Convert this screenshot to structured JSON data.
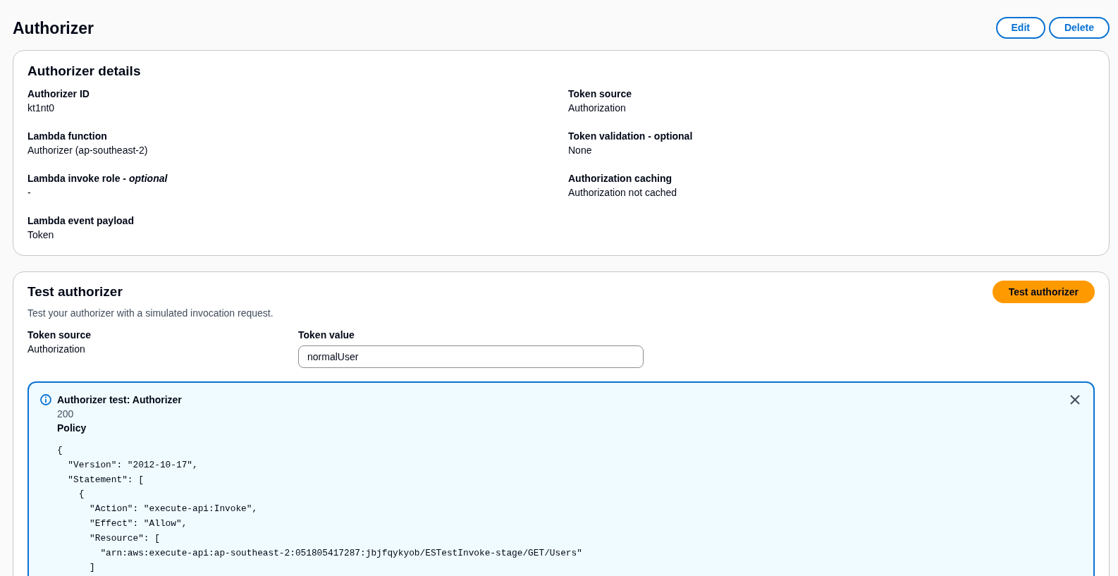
{
  "page": {
    "title": "Authorizer",
    "actions": [
      {
        "label": "Edit",
        "kind": "normal"
      },
      {
        "label": "Delete",
        "kind": "normal"
      }
    ]
  },
  "details": {
    "title": "Authorizer details",
    "columns": [
      [
        {
          "label": "Authorizer ID",
          "value": "kt1nt0"
        },
        {
          "label": "Lambda function",
          "value": "Authorizer (ap-southeast-2)"
        },
        {
          "label": "Lambda invoke role - *optional*",
          "value": "-"
        },
        {
          "label": "Lambda event payload",
          "value": "Token"
        }
      ],
      [
        {
          "label": "Token source",
          "value": "Authorization"
        },
        {
          "label": "Token validation - optional",
          "value": "None"
        },
        {
          "label": "Authorization caching",
          "value": "Authorization not cached"
        }
      ]
    ]
  },
  "test": {
    "title": "Test authorizer",
    "description": "Test your authorizer with a simulated invocation request.",
    "actions": [
      {
        "label": "Test authorizer",
        "kind": "primary"
      }
    ],
    "fields": [
      {
        "label": "Token source",
        "kind": "text",
        "value": "Authorization"
      },
      {
        "label": "Token value",
        "kind": "input",
        "value": "normalUser"
      }
    ],
    "result": {
      "kind": "info",
      "title": "Authorizer test: Authorizer",
      "dismissible": true,
      "status": "200",
      "policy_label": "Policy",
      "policy": "{\n  \"Version\": \"2012-10-17\",\n  \"Statement\": [\n    {\n      \"Action\": \"execute-api:Invoke\",\n      \"Effect\": \"Allow\",\n      \"Resource\": [\n        \"arn:aws:execute-api:ap-southeast-2:051805417287:jbjfqykyob/ESTestInvoke-stage/GET/Users\"\n      ]"
    }
  }
}
